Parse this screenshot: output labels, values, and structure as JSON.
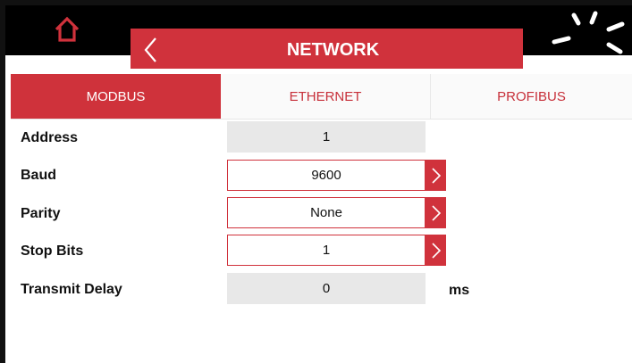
{
  "header": {
    "title": "NETWORK"
  },
  "tabs": [
    {
      "label": "MODBUS",
      "active": true
    },
    {
      "label": "ETHERNET",
      "active": false
    },
    {
      "label": "PROFIBUS",
      "active": false
    }
  ],
  "fields": {
    "address": {
      "label": "Address",
      "value": "1"
    },
    "baud": {
      "label": "Baud",
      "value": "9600"
    },
    "parity": {
      "label": "Parity",
      "value": "None"
    },
    "stop_bits": {
      "label": "Stop Bits",
      "value": "1"
    },
    "transmit_delay": {
      "label": "Transmit Delay",
      "value": "0",
      "unit": "ms"
    }
  },
  "icons": {
    "home": "home-icon",
    "back": "chevron-left-icon",
    "loading": "loading-spinner-icon",
    "select_arrow": "chevron-right-icon"
  },
  "colors": {
    "accent": "#d0323c",
    "topbar": "#000000",
    "readonly_field": "#e8e8e8"
  }
}
